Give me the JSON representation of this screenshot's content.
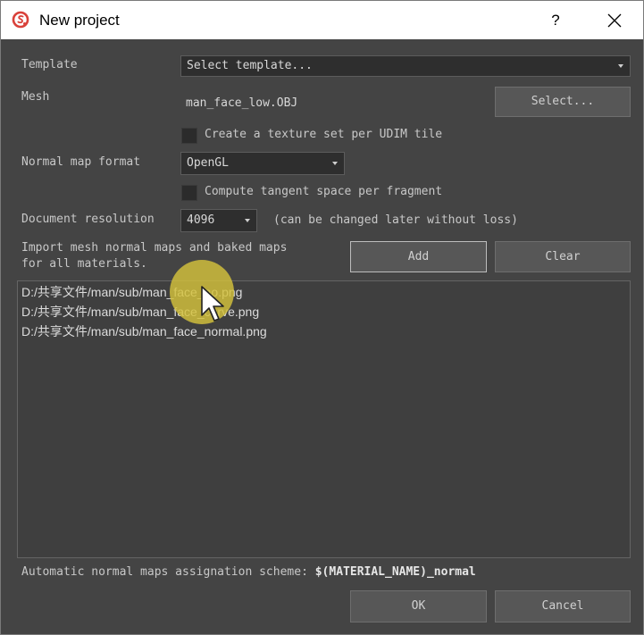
{
  "window": {
    "title": "New project",
    "help_label": "?",
    "colors": {
      "background": "#444444",
      "titlebar": "#ffffff",
      "logo_red": "#d9413a"
    }
  },
  "form": {
    "template": {
      "label": "Template",
      "value": "Select template..."
    },
    "mesh": {
      "label": "Mesh",
      "value": "man_face_low.OBJ",
      "select_button": "Select..."
    },
    "udim_checkbox": {
      "label": "Create a texture set per UDIM tile",
      "checked": false
    },
    "normal_map_format": {
      "label": "Normal map format",
      "value": "OpenGL"
    },
    "tangent_checkbox": {
      "label": "Compute tangent space per fragment",
      "checked": false
    },
    "document_resolution": {
      "label": "Document resolution",
      "value": "4096",
      "note": "(can be changed later without loss)"
    },
    "import_maps": {
      "label_line1": "Import mesh normal maps and baked maps",
      "label_line2": "for all materials.",
      "add_button": "Add",
      "clear_button": "Clear"
    },
    "files": [
      "D:/共享文件/man/sub/man_face_ao.png",
      "D:/共享文件/man/sub/man_face_curve.png",
      "D:/共享文件/man/sub/man_face_normal.png"
    ],
    "scheme": {
      "label": "Automatic normal maps assignation scheme:",
      "value": "$(MATERIAL_NAME)_normal"
    }
  },
  "footer": {
    "ok_button": "OK",
    "cancel_button": "Cancel"
  },
  "icons": {
    "app": "substance-painter-logo-icon",
    "close": "close-icon",
    "dropdown": "chevron-down-icon",
    "cursor": "mouse-pointer-icon"
  }
}
